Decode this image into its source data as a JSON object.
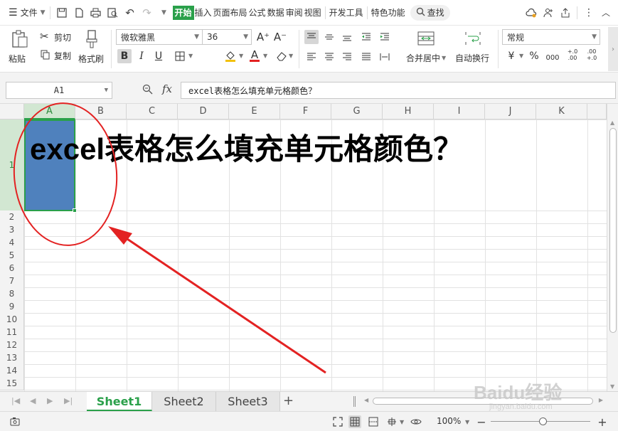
{
  "menubar": {
    "file_label": "文件",
    "tabs": [
      "开始",
      "插入",
      "页面布局",
      "公式",
      "数据",
      "审阅",
      "视图",
      "开发工具",
      "特色功能"
    ],
    "active_tab": "开始",
    "search_label": "查找"
  },
  "ribbon": {
    "paste_label": "粘贴",
    "cut_label": "剪切",
    "copy_label": "复制",
    "format_painter_label": "格式刷",
    "font_name": "微软雅黑",
    "font_size": "36",
    "merge_center_label": "合并居中",
    "wrap_text_label": "自动换行",
    "number_format": "常规",
    "percent_symbol": "%",
    "thousands_symbol": "000",
    "currency_symbol": "¥",
    "increase_decimal": "+.0 .00",
    "decrease_decimal": ".00 +.0",
    "bold_glyph": "B",
    "italic_glyph": "I",
    "underline_glyph": "U",
    "font_color_glyph": "A",
    "grow_font_glyph": "A⁺",
    "shrink_font_glyph": "A⁻"
  },
  "formula_bar": {
    "cell_ref": "A1",
    "fx_label": "fx",
    "formula": "excel表格怎么填充单元格颜色？"
  },
  "grid": {
    "columns": [
      "A",
      "B",
      "C",
      "D",
      "E",
      "F",
      "G",
      "H",
      "I",
      "J",
      "K"
    ],
    "rows": [
      "1",
      "2",
      "3",
      "4",
      "5",
      "6",
      "7",
      "8",
      "9",
      "10",
      "11",
      "12",
      "13",
      "14",
      "15"
    ],
    "selected_column": "A",
    "selected_row": "1",
    "a1_text": "excel表格怎么填充单元格颜色？",
    "a1_fill_color": "#4f81bd"
  },
  "sheets": {
    "tabs": [
      "Sheet1",
      "Sheet2",
      "Sheet3"
    ],
    "active": "Sheet1",
    "add_label": "+"
  },
  "status": {
    "zoom": "100%",
    "zoom_level": 1.0
  },
  "watermark": {
    "brand": "Baidu经验",
    "url": "jingyan.baidu.com"
  },
  "colors": {
    "accent": "#2aa04a",
    "annotation": "#e32222",
    "cell_fill": "#4f81bd"
  }
}
